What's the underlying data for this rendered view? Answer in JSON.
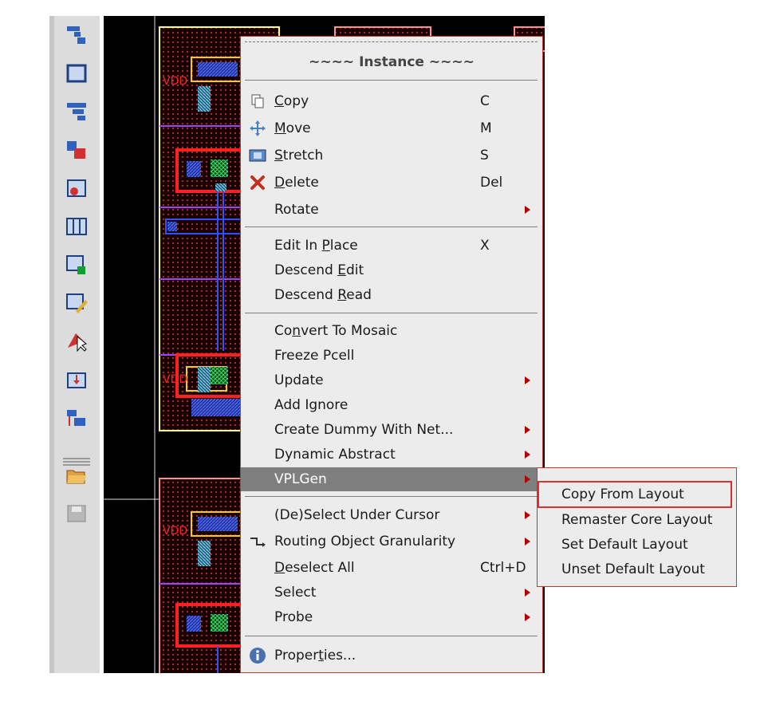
{
  "colors": {
    "menu_border": "#c0392b",
    "highlight": "#7f7f7f",
    "arrow": "#b00000",
    "callout": "#d93030"
  },
  "toolbar": {
    "icons": [
      "instance-chain-icon",
      "bounding-box-icon",
      "pattern-icon",
      "move-step-icon",
      "edit-pin-icon",
      "grid-array-icon",
      "lock-cell-icon",
      "pencil-box-icon",
      "select-cursor-icon",
      "insert-via-icon",
      "tree-route-icon",
      "open-folder-icon",
      "save-disk-icon"
    ]
  },
  "menu": {
    "title": "~~~~ Instance ~~~~",
    "items": [
      {
        "icon": "copy-icon",
        "pre": "",
        "key": "C",
        "post": "opy",
        "shortcut": "C",
        "submenu": false
      },
      {
        "icon": "move-icon",
        "pre": "",
        "key": "M",
        "post": "ove",
        "shortcut": "M",
        "submenu": false
      },
      {
        "icon": "stretch-icon",
        "pre": "",
        "key": "S",
        "post": "tretch",
        "shortcut": "S",
        "submenu": false
      },
      {
        "icon": "delete-icon",
        "pre": "",
        "key": "D",
        "post": "elete",
        "shortcut": "Del",
        "submenu": false
      },
      {
        "icon": "",
        "pre": "Rotate",
        "key": "",
        "post": "",
        "shortcut": "",
        "submenu": true
      },
      {
        "icon": "",
        "pre": "Edit In ",
        "key": "P",
        "post": "lace",
        "shortcut": "X",
        "submenu": false
      },
      {
        "icon": "",
        "pre": "Descend ",
        "key": "E",
        "post": "dit",
        "shortcut": "",
        "submenu": false
      },
      {
        "icon": "",
        "pre": "Descend ",
        "key": "R",
        "post": "ead",
        "shortcut": "",
        "submenu": false
      },
      {
        "icon": "",
        "pre": "Co",
        "key": "n",
        "post": "vert To Mosaic",
        "shortcut": "",
        "submenu": false
      },
      {
        "icon": "",
        "pre": "Freeze Pcell",
        "key": "",
        "post": "",
        "shortcut": "",
        "submenu": false
      },
      {
        "icon": "",
        "pre": "Update",
        "key": "",
        "post": "",
        "shortcut": "",
        "submenu": true
      },
      {
        "icon": "",
        "pre": "Add Ignore",
        "key": "",
        "post": "",
        "shortcut": "",
        "submenu": false
      },
      {
        "icon": "",
        "pre": "Create Dummy With Net...",
        "key": "",
        "post": "",
        "shortcut": "",
        "submenu": true
      },
      {
        "icon": "",
        "pre": "Dynamic Abstract",
        "key": "",
        "post": "",
        "shortcut": "",
        "submenu": true
      },
      {
        "icon": "",
        "pre": "VPLGen",
        "key": "",
        "post": "",
        "shortcut": "",
        "submenu": true
      },
      {
        "icon": "",
        "pre": "(De)Select Under Cursor",
        "key": "",
        "post": "",
        "shortcut": "",
        "submenu": true
      },
      {
        "icon": "routing-icon",
        "pre": "Routing Object Granularity",
        "key": "",
        "post": "",
        "shortcut": "",
        "submenu": true
      },
      {
        "icon": "",
        "pre": "",
        "key": "D",
        "post": "eselect All",
        "shortcut": "Ctrl+D",
        "submenu": false
      },
      {
        "icon": "",
        "pre": "Select",
        "key": "",
        "post": "",
        "shortcut": "",
        "submenu": true
      },
      {
        "icon": "",
        "pre": "Probe",
        "key": "",
        "post": "",
        "shortcut": "",
        "submenu": true
      },
      {
        "icon": "info-icon",
        "pre": "Proper",
        "key": "t",
        "post": "ies...",
        "shortcut": "",
        "submenu": false
      }
    ]
  },
  "submenu": {
    "items": [
      "Copy From Layout",
      "Remaster Core Layout",
      "Set Default Layout",
      "Unset Default Layout"
    ]
  }
}
